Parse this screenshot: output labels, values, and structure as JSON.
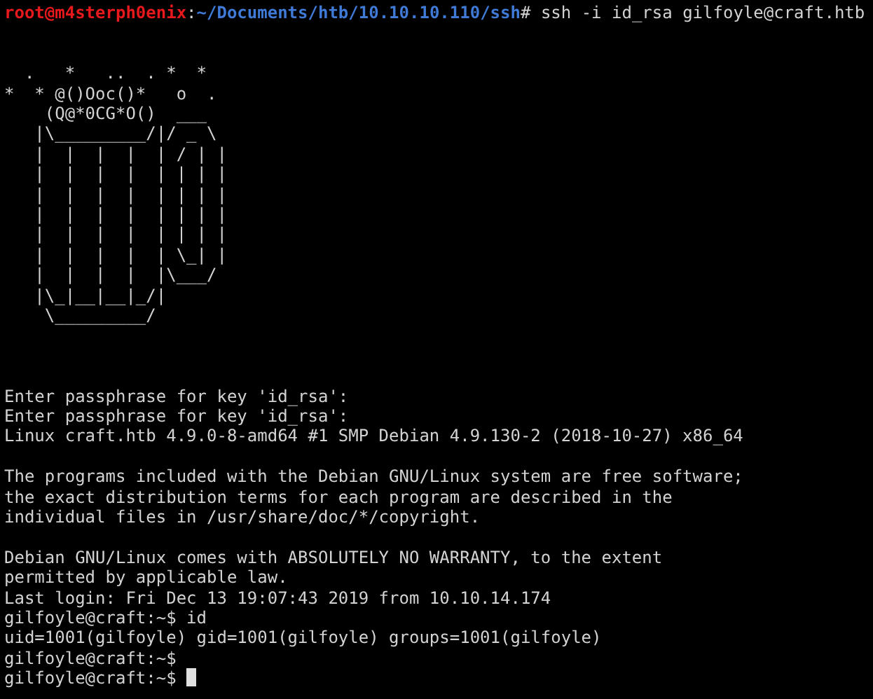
{
  "terminal": {
    "lines": [
      {
        "kind": "prompt",
        "user": "root@m4sterph0enix",
        "separator": ":",
        "path": "~/Documents/htb/10.10.10.110/ssh",
        "symbol": "#",
        "command": "ssh -i id_rsa gilfoyle@craft.htb"
      },
      {
        "kind": "blank"
      },
      {
        "kind": "blank"
      },
      {
        "kind": "art",
        "lines": [
          "  .   *   ..  . *  *",
          "*  * @()Ooc()*   o  .",
          "    (Q@*0CG*O()  ___",
          "   |\\_________/|/ _ \\",
          "   |  |  |  |  | / | |",
          "   |  |  |  |  | | | |",
          "   |  |  |  |  | | | |",
          "   |  |  |  |  | | | |",
          "   |  |  |  |  | | | |",
          "   |  |  |  |  | \\_| |",
          "   |  |  |  |  |\\___/",
          "   |\\_|__|__|_/|",
          "    \\_________/"
        ]
      },
      {
        "kind": "blank"
      },
      {
        "kind": "blank"
      },
      {
        "kind": "blank"
      },
      {
        "kind": "text",
        "text": "Enter passphrase for key 'id_rsa':"
      },
      {
        "kind": "text",
        "text": "Enter passphrase for key 'id_rsa':"
      },
      {
        "kind": "text",
        "text": "Linux craft.htb 4.9.0-8-amd64 #1 SMP Debian 4.9.130-2 (2018-10-27) x86_64"
      },
      {
        "kind": "blank"
      },
      {
        "kind": "text",
        "text": "The programs included with the Debian GNU/Linux system are free software;"
      },
      {
        "kind": "text",
        "text": "the exact distribution terms for each program are described in the"
      },
      {
        "kind": "text",
        "text": "individual files in /usr/share/doc/*/copyright."
      },
      {
        "kind": "blank"
      },
      {
        "kind": "text",
        "text": "Debian GNU/Linux comes with ABSOLUTELY NO WARRANTY, to the extent"
      },
      {
        "kind": "text",
        "text": "permitted by applicable law."
      },
      {
        "kind": "text",
        "text": "Last login: Fri Dec 13 19:07:43 2019 from 10.10.14.174"
      },
      {
        "kind": "text",
        "text": "gilfoyle@craft:~$ id"
      },
      {
        "kind": "text",
        "text": "uid=1001(gilfoyle) gid=1001(gilfoyle) groups=1001(gilfoyle)"
      },
      {
        "kind": "text",
        "text": "gilfoyle@craft:~$"
      },
      {
        "kind": "input",
        "text": "gilfoyle@craft:~$ "
      }
    ]
  }
}
